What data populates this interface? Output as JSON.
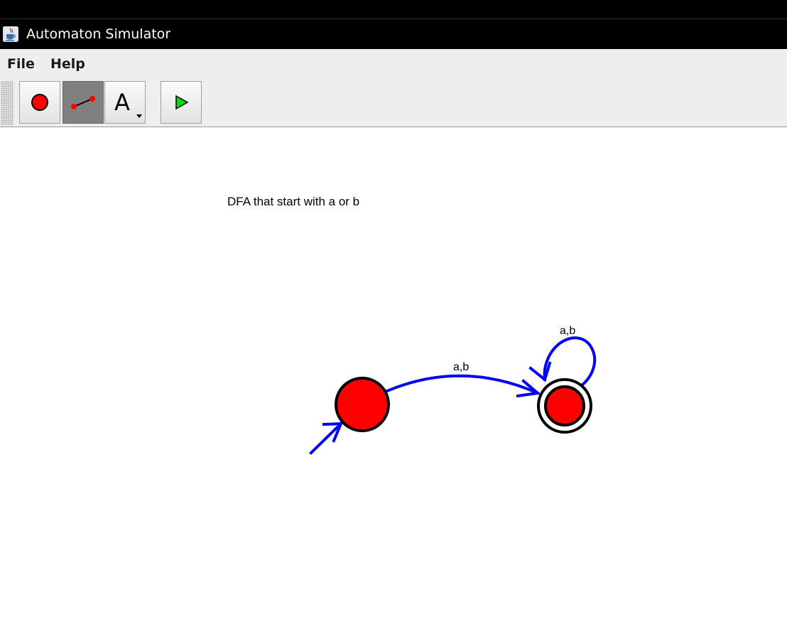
{
  "window": {
    "title": "Automaton Simulator"
  },
  "menu": {
    "items": [
      "File",
      "Help"
    ]
  },
  "toolbar": {
    "buttons": [
      {
        "icon": "state-tool-icon",
        "selected": false
      },
      {
        "icon": "transition-tool-icon",
        "selected": true
      },
      {
        "icon": "text-tool-icon",
        "text": "A",
        "selected": false
      },
      {
        "icon": "run-icon",
        "selected": false
      }
    ]
  },
  "diagram": {
    "caption": "DFA that start with a or b",
    "states": [
      {
        "id": "q0",
        "initial": true,
        "accepting": false
      },
      {
        "id": "q1",
        "initial": false,
        "accepting": true
      }
    ],
    "transitions": [
      {
        "from": "q0",
        "to": "q1",
        "label": "a,b"
      },
      {
        "from": "q1",
        "to": "q1",
        "label": "a,b"
      }
    ]
  },
  "colors": {
    "state_fill": "#ff0000",
    "edge_stroke": "#0000ff",
    "titlebar_bg": "#000000",
    "menubar_bg": "#eeeeee",
    "selected_tool_bg": "#808080",
    "run_triangle": "#00dd00"
  }
}
